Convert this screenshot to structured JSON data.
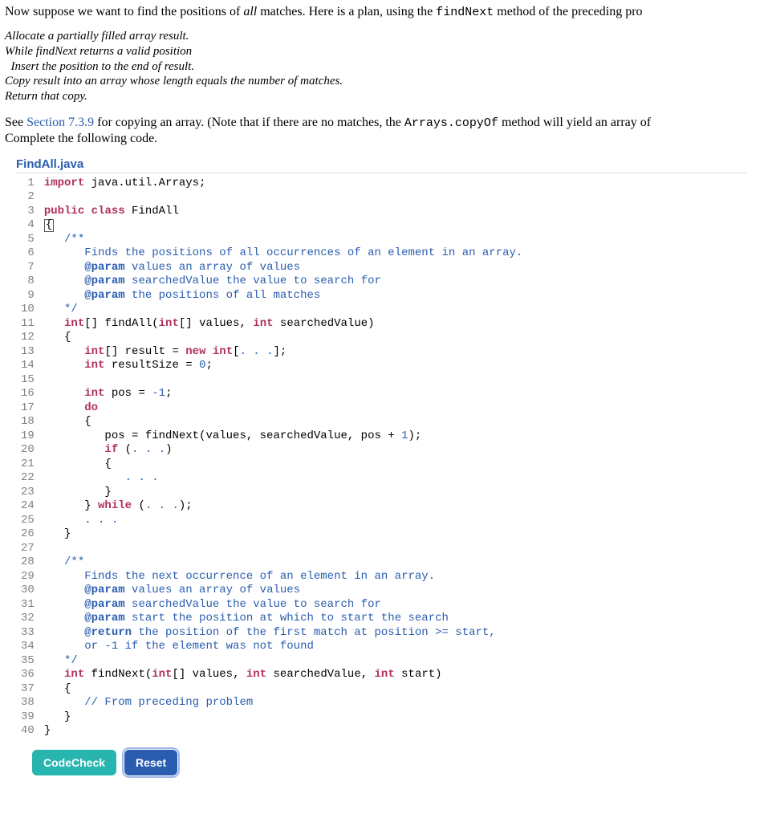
{
  "intro": {
    "prefix": "Now suppose we want to find the positions of ",
    "emph": "all",
    "mid": " matches. Here is a plan, using the ",
    "code": "findNext",
    "suffix": " method of the preceding pro"
  },
  "pseudo": "Allocate a partially filled array result.\nWhile findNext returns a valid position\n  Insert the position to the end of result.\nCopy result into an array whose length equals the number of matches.\nReturn that copy.",
  "see": {
    "prefix": "See ",
    "link": "Section 7.3.9",
    "mid": " for copying an array. (Note that if there are no matches, the ",
    "code": "Arrays.copyOf",
    "suffix": " method will yield an array of"
  },
  "complete": "Complete the following code.",
  "filename": "FindAll.java",
  "gutter": " 1\n 2\n 3\n 4\n 5\n 6\n 7\n 8\n 9\n10\n11\n12\n13\n14\n15\n16\n17\n18\n19\n20\n21\n22\n23\n24\n25\n26\n27\n28\n29\n30\n31\n32\n33\n34\n35\n36\n37\n38\n39\n40",
  "code": {
    "l1a": "import",
    "l1b": " java.util.Arrays;",
    "l3a": "public",
    "l3b": " class",
    "l3c": " FindAll",
    "l4a": "{",
    "l5a": "   /**",
    "l6a": "      Finds the positions of all occurrences of an element in an array.",
    "l7a": "      @param",
    "l7b": " values an array of values",
    "l8a": "      @param",
    "l8b": " searchedValue the value to search for",
    "l9a": "      @param",
    "l9b": " the positions of all matches",
    "l10a": "   */",
    "l11a": "   int",
    "l11b": "[] findAll(",
    "l11c": "int",
    "l11d": "[] values, ",
    "l11e": "int",
    "l11f": " searchedValue)",
    "l12a": "   {",
    "l13a": "      int",
    "l13b": "[] result = ",
    "l13c": "new",
    "l13d": " int",
    "l13e": "[",
    "l13f": ". . .",
    "l13g": "];",
    "l14a": "      int",
    "l14b": " resultSize = ",
    "l14c": "0",
    "l14d": ";",
    "l16a": "      int",
    "l16b": " pos = ",
    "l16c": "-1",
    "l16d": ";",
    "l17a": "      do",
    "l18a": "      {",
    "l19a": "         pos = findNext(values, searchedValue, pos + ",
    "l19b": "1",
    "l19c": ");",
    "l20a": "         if",
    "l20b": " (",
    "l20c": ". . .",
    "l20d": ")",
    "l21a": "         {",
    "l22a": "            ",
    "l22b": ". . .",
    "l23a": "         }",
    "l24a": "      } ",
    "l24b": "while",
    "l24c": " (",
    "l24d": ". . .",
    "l24e": ");",
    "l25a": "      ",
    "l25b": ". . .",
    "l26a": "   }",
    "l28a": "   /**",
    "l29a": "      Finds the next occurrence of an element in an array.",
    "l30a": "      @param",
    "l30b": " values an array of values",
    "l31a": "      @param",
    "l31b": " searchedValue the value to search for",
    "l32a": "      @param",
    "l32b": " start the position at which to start the search",
    "l33a": "      @return",
    "l33b": " the position of the first match at position >= start,",
    "l34a": "      or -1 if the element was not found",
    "l35a": "   */",
    "l36a": "   int",
    "l36b": " findNext(",
    "l36c": "int",
    "l36d": "[] values, ",
    "l36e": "int",
    "l36f": " searchedValue, ",
    "l36g": "int",
    "l36h": " start)",
    "l37a": "   {",
    "l38a": "      // From preceding problem",
    "l39a": "   }",
    "l40a": "}"
  },
  "buttons": {
    "codecheck": "CodeCheck",
    "reset": "Reset"
  }
}
